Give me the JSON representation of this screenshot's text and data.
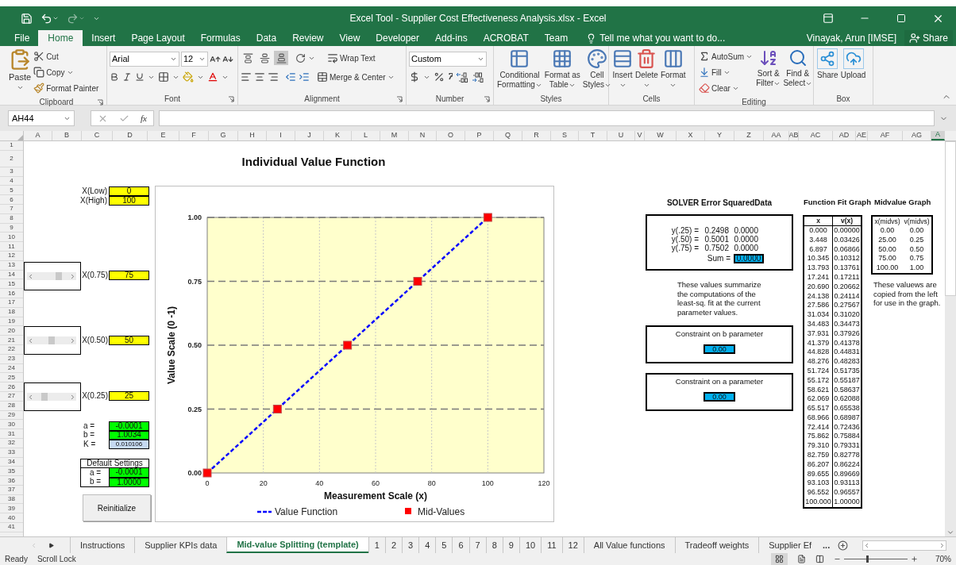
{
  "title_bar": {
    "title": "Excel Tool - Supplier Cost Effectiveness Analysis.xlsx - Excel"
  },
  "menu_tabs": [
    {
      "label": "File",
      "selected": false
    },
    {
      "label": "Home",
      "selected": true
    },
    {
      "label": "Insert",
      "selected": false
    },
    {
      "label": "Page Layout",
      "selected": false
    },
    {
      "label": "Formulas",
      "selected": false
    },
    {
      "label": "Data",
      "selected": false
    },
    {
      "label": "Review",
      "selected": false
    },
    {
      "label": "View",
      "selected": false
    },
    {
      "label": "Developer",
      "selected": false
    },
    {
      "label": "Add-ins",
      "selected": false
    },
    {
      "label": "ACROBAT",
      "selected": false
    },
    {
      "label": "Team",
      "selected": false
    }
  ],
  "tell_me": {
    "placeholder": "Tell me what you want to do..."
  },
  "user": "Vinayak, Arun [IMSE]",
  "share_button": "Share",
  "ribbon": {
    "clipboard": {
      "label": "Clipboard",
      "paste": "Paste",
      "cut": "Cut",
      "copy": "Copy",
      "format_painter": "Format Painter"
    },
    "font": {
      "label": "Font",
      "font_name": "Arial",
      "font_size": "12"
    },
    "alignment": {
      "label": "Alignment",
      "vertical_align": [
        {
          "selected": false
        },
        {
          "selected": false
        },
        {
          "selected": true
        }
      ],
      "wrap_text": "Wrap Text",
      "merge_center": "Merge & Center"
    },
    "number": {
      "label": "Number",
      "format": "Custom"
    },
    "styles": {
      "label": "Styles",
      "buttons": [
        [
          "Conditional",
          "Formatting"
        ],
        [
          "Format as",
          "Table"
        ],
        [
          "Cell",
          "Styles"
        ]
      ]
    },
    "cells": {
      "label": "Cells",
      "buttons": [
        "Insert",
        "Delete",
        "Format"
      ]
    },
    "editing": {
      "label": "Editing",
      "autosum": "AutoSum",
      "fill": "Fill",
      "clear": "Clear",
      "sort": [
        "Sort &",
        "Filter"
      ],
      "find": [
        "Find &",
        "Select"
      ]
    },
    "box": {
      "label": "Box",
      "buttons": [
        "Share",
        "Upload"
      ]
    }
  },
  "formula_bar": {
    "name_box": "AH44",
    "function_label": "fx"
  },
  "columns": [
    {
      "label": "A",
      "selected": false
    },
    {
      "label": "B",
      "selected": false
    },
    {
      "label": "C",
      "selected": false
    },
    {
      "label": "D",
      "selected": false
    },
    {
      "label": "E",
      "selected": false
    },
    {
      "label": "F",
      "selected": false
    },
    {
      "label": "G",
      "selected": false
    },
    {
      "label": "H",
      "selected": false
    },
    {
      "label": "I",
      "selected": false
    },
    {
      "label": "J",
      "selected": false
    },
    {
      "label": "K",
      "selected": false
    },
    {
      "label": "L",
      "selected": false
    },
    {
      "label": "M",
      "selected": false
    },
    {
      "label": "N",
      "selected": false
    },
    {
      "label": "O",
      "selected": false
    },
    {
      "label": "P",
      "selected": false
    },
    {
      "label": "Q",
      "selected": false
    },
    {
      "label": "R",
      "selected": false
    },
    {
      "label": "S",
      "selected": false
    },
    {
      "label": "T",
      "selected": false
    },
    {
      "label": "U",
      "selected": false
    },
    {
      "label": "V",
      "selected": false
    },
    {
      "label": "W",
      "selected": false
    },
    {
      "label": "X",
      "selected": false
    },
    {
      "label": "Y",
      "selected": false
    },
    {
      "label": "Z",
      "selected": false
    },
    {
      "label": "AA",
      "selected": false
    },
    {
      "label": "AB",
      "selected": false
    },
    {
      "label": "AC",
      "selected": false
    },
    {
      "label": "AD",
      "selected": false
    },
    {
      "label": "AE",
      "selected": false
    },
    {
      "label": "AF",
      "selected": false
    },
    {
      "label": "AG",
      "selected": false
    },
    {
      "label": "A",
      "selected": true
    }
  ],
  "rows": [
    "1",
    "2",
    "3",
    "4",
    "5",
    "6",
    "7",
    "8",
    "9",
    "10",
    "11",
    "12",
    "13",
    "14",
    "15",
    "16",
    "17",
    "18",
    "19",
    "20",
    "21",
    "22",
    "23",
    "24",
    "25",
    "26",
    "27",
    "28",
    "29",
    "30",
    "31",
    "32",
    "33",
    "34",
    "35",
    "36",
    "37",
    "38",
    "39",
    "40",
    "41"
  ],
  "sheet": {
    "title": "Individual Value Function",
    "inputs": [
      {
        "label": "X(Low)",
        "value": "0"
      },
      {
        "label": "X(High)",
        "value": "100"
      }
    ],
    "sliders": [
      {
        "label": "X(0.75)",
        "value": "75"
      },
      {
        "label": "X(0.50)",
        "value": "50"
      },
      {
        "label": "X(0.25)",
        "value": "25"
      }
    ],
    "params": [
      {
        "label": "a =",
        "value": "-0.0001",
        "color": "#00ff00"
      },
      {
        "label": "b =",
        "value": "1.0034",
        "color": "#00ff00"
      },
      {
        "label": "K =",
        "value": "0.010106",
        "color": "#c5d9f1"
      }
    ],
    "defaults": {
      "title": "Default Settings",
      "params": [
        {
          "label": "a =",
          "value": "-0.0001"
        },
        {
          "label": "b =",
          "value": "1.0000"
        }
      ]
    },
    "reinitialize_button": "Reinitialize",
    "chart": {
      "chart_data": {
        "type": "scatter",
        "xlabel": "Measurement Scale (x)",
        "ylabel": "Value Scale (0 -1)",
        "x": [
          0,
          25,
          50,
          75,
          100
        ],
        "series": [
          {
            "name": "Value Function",
            "type": "line",
            "color": "#0000ff",
            "line_style": "dashed",
            "values": [
              0,
              0.25,
              0.5,
              0.75,
              1
            ]
          },
          {
            "name": "Mid-Values",
            "color": "#ff0000",
            "line_style": "none",
            "marker": "square",
            "values": [
              0,
              0.25,
              0.5,
              0.75,
              1
            ]
          }
        ],
        "grid": true,
        "legend": "bottom",
        "xlim": [
          0,
          120
        ],
        "ylim": [
          0,
          1
        ],
        "xticks": [
          0,
          20,
          40,
          60,
          80,
          100,
          120
        ],
        "yticks": [
          {
            "value": 0,
            "label": "0.00"
          },
          {
            "value": 0.25,
            "label": "0.25"
          },
          {
            "value": 0.5,
            "label": "0.50"
          },
          {
            "value": 0.75,
            "label": "0.75"
          },
          {
            "value": 1,
            "label": "1.00"
          }
        ]
      }
    },
    "solver": {
      "title": "SOLVER Error SquaredData",
      "rows": [
        {
          "label": "y(.25) =",
          "value": "0.2498",
          "error": "0.0000"
        },
        {
          "label": "y(.50) =",
          "value": "0.5001",
          "error": "0.0000"
        },
        {
          "label": "y(.75) =",
          "value": "0.7502",
          "error": "0.0000"
        }
      ],
      "sum_label": "Sum =",
      "sum": "0.0000",
      "note": "These values summarize the computations of the least-sq. fit at the current parameter values."
    },
    "constraints": [
      {
        "label": "Constraint on b parameter",
        "value": "0.00"
      },
      {
        "label": "Constraint on a parameter",
        "value": "0.00"
      }
    ],
    "fit_table": {
      "title": "Function Fit Graph",
      "columns": [
        "x",
        "v(x)"
      ],
      "rows": [
        [
          "0.000",
          "0.00000"
        ],
        [
          "3.448",
          "0.03426"
        ],
        [
          "6.897",
          "0.06866"
        ],
        [
          "10.345",
          "0.10312"
        ],
        [
          "13.793",
          "0.13761"
        ],
        [
          "17.241",
          "0.17211"
        ],
        [
          "20.690",
          "0.20662"
        ],
        [
          "24.138",
          "0.24114"
        ],
        [
          "27.586",
          "0.27567"
        ],
        [
          "31.034",
          "0.31020"
        ],
        [
          "34.483",
          "0.34473"
        ],
        [
          "37.931",
          "0.37926"
        ],
        [
          "41.379",
          "0.41378"
        ],
        [
          "44.828",
          "0.44831"
        ],
        [
          "48.276",
          "0.48283"
        ],
        [
          "51.724",
          "0.51735"
        ],
        [
          "55.172",
          "0.55187"
        ],
        [
          "58.621",
          "0.58637"
        ],
        [
          "62.069",
          "0.62088"
        ],
        [
          "65.517",
          "0.65538"
        ],
        [
          "68.966",
          "0.68987"
        ],
        [
          "72.414",
          "0.72436"
        ],
        [
          "75.862",
          "0.75884"
        ],
        [
          "79.310",
          "0.79331"
        ],
        [
          "82.759",
          "0.82778"
        ],
        [
          "86.207",
          "0.86224"
        ],
        [
          "89.655",
          "0.89669"
        ],
        [
          "93.103",
          "0.93113"
        ],
        [
          "96.552",
          "0.96557"
        ],
        [
          "100.000",
          "1.00000"
        ]
      ]
    },
    "midvalue_table": {
      "title": "Midvalue Graph",
      "columns": [
        "x(midvs)",
        "v(midvs)"
      ],
      "rows": [
        [
          "0.00",
          "0.00"
        ],
        [
          "25.00",
          "0.25"
        ],
        [
          "50.00",
          "0.50"
        ],
        [
          "75.00",
          "0.75"
        ],
        [
          "100.00",
          "1.00"
        ]
      ],
      "note": "These valuews are copied from the left for use in the graph."
    }
  },
  "sheet_tabs": [
    {
      "label": "Instructions",
      "selected": false
    },
    {
      "label": "Supplier KPIs data",
      "selected": false
    },
    {
      "label": "Mid-value Splitting (template)",
      "selected": true
    },
    {
      "label": "1",
      "selected": false
    },
    {
      "label": "2",
      "selected": false
    },
    {
      "label": "3",
      "selected": false
    },
    {
      "label": "4",
      "selected": false
    },
    {
      "label": "5",
      "selected": false
    },
    {
      "label": "6",
      "selected": false
    },
    {
      "label": "7",
      "selected": false
    },
    {
      "label": "8",
      "selected": false
    },
    {
      "label": "9",
      "selected": false
    },
    {
      "label": "10",
      "selected": false
    },
    {
      "label": "11",
      "selected": false
    },
    {
      "label": "12",
      "selected": false
    },
    {
      "label": "All Value functions",
      "selected": false
    },
    {
      "label": "Tradeoff weights",
      "selected": false
    },
    {
      "label": "Supplier Ef",
      "selected": false
    }
  ],
  "more_tabs": "...",
  "status_bar": {
    "items": [
      "Ready",
      "Scroll Lock"
    ],
    "zoom_slider": {
      "level": 0.35
    },
    "zoom": "70%"
  }
}
